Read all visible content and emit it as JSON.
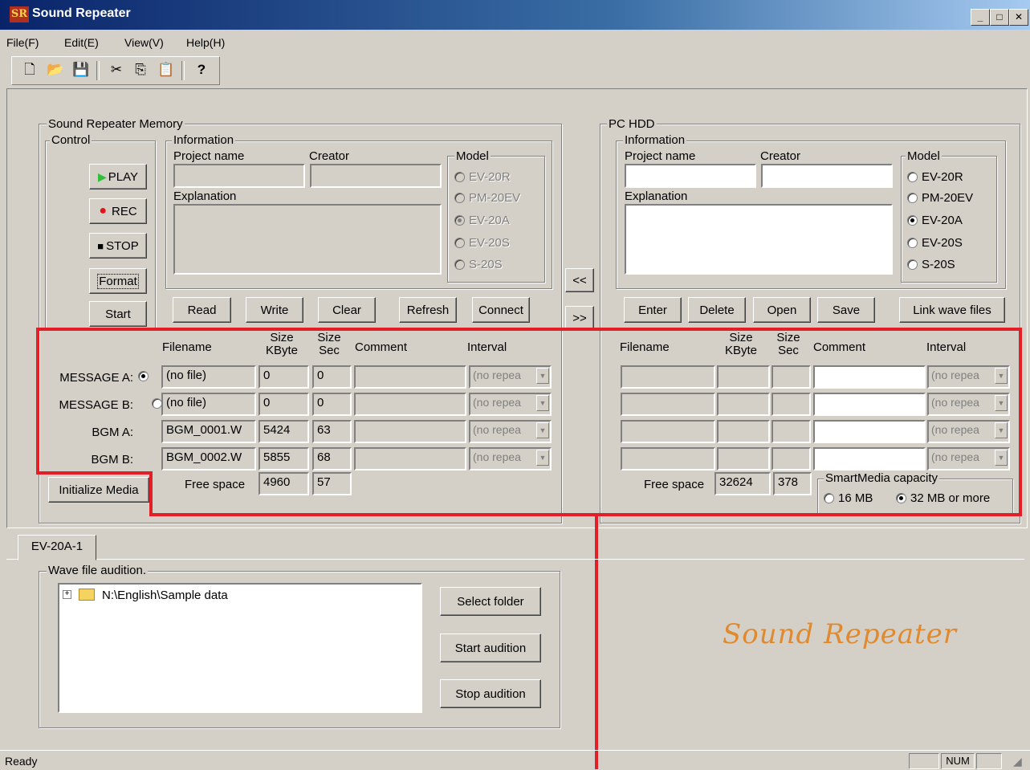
{
  "window": {
    "title": "Sound Repeater",
    "icon_text": "SR"
  },
  "menu": [
    {
      "label": "File(F)"
    },
    {
      "label": "Edit(E)"
    },
    {
      "label": "View(V)"
    },
    {
      "label": "Help(H)"
    }
  ],
  "toolbar": {
    "icons": [
      "new-file-icon",
      "open-folder-icon",
      "save-icon",
      "cut-icon",
      "copy-icon",
      "paste-icon",
      "help-icon"
    ],
    "glyphs": [
      "🗋",
      "📂",
      "💾",
      "✂",
      "⎘",
      "📋",
      "?"
    ]
  },
  "memory": {
    "title": "Sound Repeater Memory",
    "control": {
      "title": "Control",
      "play": "PLAY",
      "rec": "REC",
      "stop": "STOP",
      "format": "Format",
      "start": "Start"
    },
    "info": {
      "title": "Information",
      "project_label": "Project name",
      "creator_label": "Creator",
      "explanation_label": "Explanation",
      "project_value": "",
      "creator_value": ""
    },
    "model": {
      "title": "Model",
      "options": [
        "EV-20R",
        "PM-20EV",
        "EV-20A",
        "EV-20S",
        "S-20S"
      ],
      "selected": "EV-20A"
    },
    "buttons": {
      "read": "Read",
      "write": "Write",
      "clear": "Clear",
      "refresh": "Refresh",
      "connect": "Connect"
    },
    "headers": {
      "filename": "Filename",
      "size_kbyte": "Size KByte",
      "size_sec": "Size Sec",
      "comment": "Comment",
      "interval": "Interval"
    },
    "rows": [
      {
        "label": "MESSAGE A:",
        "selected": true,
        "filename": "(no file)",
        "kbyte": "0",
        "sec": "0",
        "comment": "",
        "interval": "(no repea"
      },
      {
        "label": "MESSAGE B:",
        "selected": false,
        "filename": "(no file)",
        "kbyte": "0",
        "sec": "0",
        "comment": "",
        "interval": "(no repea"
      },
      {
        "label": "BGM A:",
        "selected": false,
        "filename": "BGM_0001.W",
        "kbyte": "5424",
        "sec": "63",
        "comment": "",
        "interval": "(no repea"
      },
      {
        "label": "BGM B:",
        "selected": false,
        "filename": "BGM_0002.W",
        "kbyte": "5855",
        "sec": "68",
        "comment": "",
        "interval": "(no repea"
      }
    ],
    "free_space_label": "Free space",
    "free_kbyte": "4960",
    "free_sec": "57",
    "initialize_media": "Initialize Media"
  },
  "transfer": {
    "to_left": "<<",
    "to_right": ">>"
  },
  "pc": {
    "title": "PC HDD",
    "info": {
      "title": "Information",
      "project_label": "Project name",
      "creator_label": "Creator",
      "explanation_label": "Explanation"
    },
    "model": {
      "title": "Model",
      "options": [
        "EV-20R",
        "PM-20EV",
        "EV-20A",
        "EV-20S",
        "S-20S"
      ],
      "selected": "EV-20A"
    },
    "buttons": {
      "enter": "Enter",
      "delete": "Delete",
      "open": "Open",
      "save": "Save",
      "link": "Link wave files"
    },
    "headers": {
      "filename": "Filename",
      "size_kbyte": "Size KByte",
      "size_sec": "Size Sec",
      "comment": "Comment",
      "interval": "Interval"
    },
    "rows": [
      {
        "filename": "",
        "kbyte": "",
        "sec": "",
        "comment": "",
        "interval": "(no repea"
      },
      {
        "filename": "",
        "kbyte": "",
        "sec": "",
        "comment": "",
        "interval": "(no repea"
      },
      {
        "filename": "",
        "kbyte": "",
        "sec": "",
        "comment": "",
        "interval": "(no repea"
      },
      {
        "filename": "",
        "kbyte": "",
        "sec": "",
        "comment": "",
        "interval": "(no repea"
      }
    ],
    "free_space_label": "Free space",
    "free_kbyte": "32624",
    "free_sec": "378",
    "capacity": {
      "title": "SmartMedia capacity",
      "opt16": "16 MB",
      "opt32": "32 MB or more",
      "selected": "32 MB or more"
    }
  },
  "tab": {
    "label": "EV-20A-1"
  },
  "audition": {
    "title": "Wave file audition.",
    "tree_item": "N:\\English\\Sample data",
    "select_folder": "Select folder",
    "start": "Start audition",
    "stop": "Stop audition"
  },
  "brand_text": "Sound Repeater",
  "status": {
    "text": "Ready",
    "num": "NUM"
  },
  "colors": {
    "highlight_red": "#e21f26",
    "brand_orange": "#e08a30",
    "titlebar_blue": "#0a246a"
  }
}
